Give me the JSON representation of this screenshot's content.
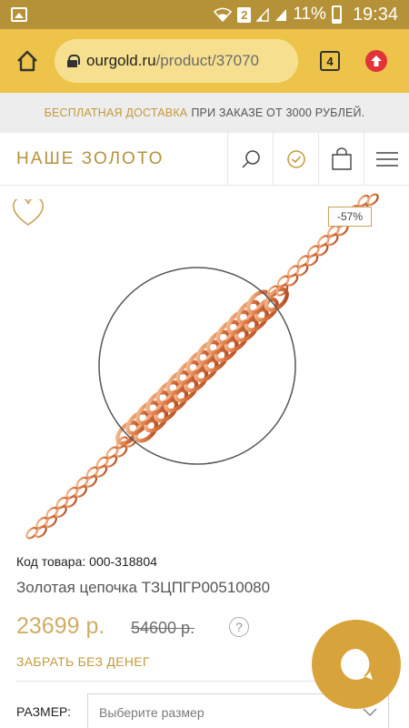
{
  "status_bar": {
    "battery_percent": "11%",
    "time": "19:34",
    "sim_badge": "2"
  },
  "browser": {
    "url_host": "ourgold.ru",
    "url_path": "/product/37070",
    "tab_count": "4"
  },
  "promo": {
    "accent_text": "БЕСПЛАТНАЯ ДОСТАВКА",
    "rest_text": "ПРИ ЗАКАЗЕ ОТ 3000 РУБЛЕЙ."
  },
  "header": {
    "logo": "НАШЕ ЗОЛОТО"
  },
  "product": {
    "discount": "-57%",
    "sku": "Код товара: 000-318804",
    "name": "Золотая цепочка ТЗЦПГР00510080",
    "price": "23699 р.",
    "old_price": "54600 р.",
    "help_mark": "?",
    "credit_link": "ЗАБРАТЬ БЕЗ ДЕНЕГ",
    "size_label": "РАЗМЕР:",
    "size_placeholder": "Выберите размер"
  },
  "colors": {
    "status_bar": "#b59238",
    "browser_bar": "#edc34a",
    "accent_gold": "#c39a3c",
    "chat_button": "#d8a33a",
    "update_badge": "#e0333a"
  }
}
